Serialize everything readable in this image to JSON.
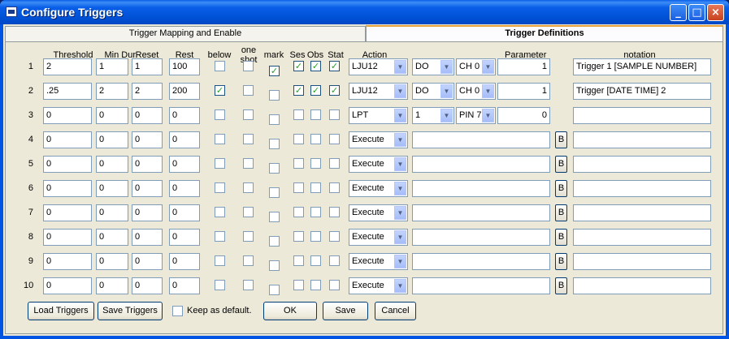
{
  "window": {
    "title": "Configure Triggers",
    "min": "_",
    "max": "□",
    "close": "×"
  },
  "tabs": [
    {
      "label": "Trigger Mapping and Enable"
    },
    {
      "label": "Trigger Definitions"
    }
  ],
  "headers": {
    "threshold": "Threshold",
    "min_dur": "Min Dur.",
    "reset": "Reset",
    "rest": "Rest",
    "below": "below",
    "one_shot_1": "one",
    "one_shot_2": "shot",
    "mark": "mark",
    "ses": "Ses",
    "obs": "Obs",
    "stat": "Stat",
    "action": "Action",
    "parameter": "Parameter",
    "notation": "notation"
  },
  "rows": [
    {
      "num": "1",
      "threshold": "2",
      "min_dur": "1",
      "reset": "1",
      "rest": "100",
      "below": false,
      "one_shot": false,
      "mark": true,
      "ses": true,
      "obs": true,
      "stat": true,
      "action": "LJU12",
      "p1": "DO",
      "p2": "CH 0",
      "param": "1",
      "notation": "Trigger 1 [SAMPLE NUMBER]"
    },
    {
      "num": "2",
      "threshold": ".25",
      "min_dur": "2",
      "reset": "2",
      "rest": "200",
      "below": true,
      "one_shot": false,
      "mark": false,
      "ses": true,
      "obs": true,
      "stat": true,
      "action": "LJU12",
      "p1": "DO",
      "p2": "CH 0",
      "param": "1",
      "notation": "Trigger [DATE TIME] 2"
    },
    {
      "num": "3",
      "threshold": "0",
      "min_dur": "0",
      "reset": "0",
      "rest": "0",
      "below": false,
      "one_shot": false,
      "mark": false,
      "ses": false,
      "obs": false,
      "stat": false,
      "action": "LPT",
      "p1": "1",
      "p2": "PIN 7",
      "param": "0",
      "notation": ""
    },
    {
      "num": "4",
      "threshold": "0",
      "min_dur": "0",
      "reset": "0",
      "rest": "0",
      "below": false,
      "one_shot": false,
      "mark": false,
      "ses": false,
      "obs": false,
      "stat": false,
      "action": "Execute",
      "param": "",
      "b": "B",
      "notation": ""
    },
    {
      "num": "5",
      "threshold": "0",
      "min_dur": "0",
      "reset": "0",
      "rest": "0",
      "below": false,
      "one_shot": false,
      "mark": false,
      "ses": false,
      "obs": false,
      "stat": false,
      "action": "Execute",
      "param": "",
      "b": "B",
      "notation": ""
    },
    {
      "num": "6",
      "threshold": "0",
      "min_dur": "0",
      "reset": "0",
      "rest": "0",
      "below": false,
      "one_shot": false,
      "mark": false,
      "ses": false,
      "obs": false,
      "stat": false,
      "action": "Execute",
      "param": "",
      "b": "B",
      "notation": ""
    },
    {
      "num": "7",
      "threshold": "0",
      "min_dur": "0",
      "reset": "0",
      "rest": "0",
      "below": false,
      "one_shot": false,
      "mark": false,
      "ses": false,
      "obs": false,
      "stat": false,
      "action": "Execute",
      "param": "",
      "b": "B",
      "notation": ""
    },
    {
      "num": "8",
      "threshold": "0",
      "min_dur": "0",
      "reset": "0",
      "rest": "0",
      "below": false,
      "one_shot": false,
      "mark": false,
      "ses": false,
      "obs": false,
      "stat": false,
      "action": "Execute",
      "param": "",
      "b": "B",
      "notation": ""
    },
    {
      "num": "9",
      "threshold": "0",
      "min_dur": "0",
      "reset": "0",
      "rest": "0",
      "below": false,
      "one_shot": false,
      "mark": false,
      "ses": false,
      "obs": false,
      "stat": false,
      "action": "Execute",
      "param": "",
      "b": "B",
      "notation": ""
    },
    {
      "num": "10",
      "threshold": "0",
      "min_dur": "0",
      "reset": "0",
      "rest": "0",
      "below": false,
      "one_shot": false,
      "mark": false,
      "ses": false,
      "obs": false,
      "stat": false,
      "action": "Execute",
      "param": "",
      "b": "B",
      "notation": ""
    }
  ],
  "footer": {
    "load": "Load Triggers",
    "save_triggers": "Save Triggers",
    "keep_default": "Keep as default.",
    "keep_default_checked": false,
    "ok": "OK",
    "save": "Save",
    "cancel": "Cancel"
  },
  "colors": {
    "titlebar": "#0a5fe8",
    "client": "#ece9d8",
    "check": "#21a121"
  }
}
